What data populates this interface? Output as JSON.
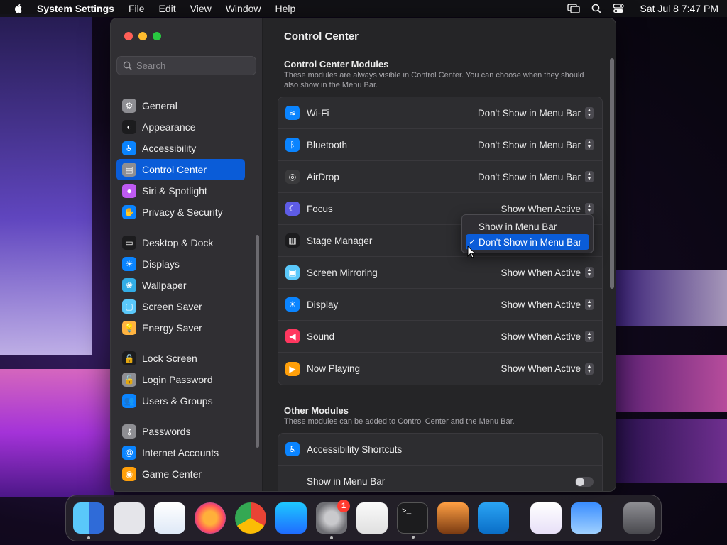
{
  "menubar": {
    "app_name": "System Settings",
    "menus": [
      "File",
      "Edit",
      "View",
      "Window",
      "Help"
    ],
    "clock": "Sat Jul 8  7:47 PM"
  },
  "sidebar": {
    "search_placeholder": "Search",
    "groups": [
      [
        {
          "label": "General",
          "icon": "gear-icon",
          "color": "#8e8e93"
        },
        {
          "label": "Appearance",
          "icon": "appearance-icon",
          "color": "#1c1c1e"
        },
        {
          "label": "Accessibility",
          "icon": "accessibility-icon",
          "color": "#0a84ff"
        },
        {
          "label": "Control Center",
          "icon": "control-center-icon",
          "color": "#8e8e93",
          "active": true
        },
        {
          "label": "Siri & Spotlight",
          "icon": "siri-icon",
          "color": "#bf5af2"
        },
        {
          "label": "Privacy & Security",
          "icon": "hand-icon",
          "color": "#0a84ff"
        }
      ],
      [
        {
          "label": "Desktop & Dock",
          "icon": "dock-icon",
          "color": "#1c1c1e"
        },
        {
          "label": "Displays",
          "icon": "sun-icon",
          "color": "#0a84ff"
        },
        {
          "label": "Wallpaper",
          "icon": "wallpaper-icon",
          "color": "#32ade6"
        },
        {
          "label": "Screen Saver",
          "icon": "screen-saver-icon",
          "color": "#5ac8fa"
        },
        {
          "label": "Energy Saver",
          "icon": "bulb-icon",
          "color": "#ffb340"
        }
      ],
      [
        {
          "label": "Lock Screen",
          "icon": "lock-icon",
          "color": "#1c1c1e"
        },
        {
          "label": "Login Password",
          "icon": "login-lock-icon",
          "color": "#8e8e93"
        },
        {
          "label": "Users & Groups",
          "icon": "users-icon",
          "color": "#0a84ff"
        }
      ],
      [
        {
          "label": "Passwords",
          "icon": "key-icon",
          "color": "#8e8e93"
        },
        {
          "label": "Internet Accounts",
          "icon": "at-icon",
          "color": "#0a84ff"
        },
        {
          "label": "Game Center",
          "icon": "game-center-icon",
          "color": "#ff9f0a"
        }
      ]
    ]
  },
  "main": {
    "title": "Control Center",
    "modules_section": {
      "heading": "Control Center Modules",
      "description": "These modules are always visible in Control Center. You can choose when they should also show in the Menu Bar.",
      "rows": [
        {
          "label": "Wi-Fi",
          "value": "Don't Show in Menu Bar",
          "icon": "wifi-icon",
          "color": "#0a84ff"
        },
        {
          "label": "Bluetooth",
          "value": "Don't Show in Menu Bar",
          "icon": "bluetooth-icon",
          "color": "#0a84ff"
        },
        {
          "label": "AirDrop",
          "value": "Don't Show in Menu Bar",
          "icon": "airdrop-icon",
          "color": "#3a3a3c"
        },
        {
          "label": "Focus",
          "value": "Show When Active",
          "icon": "moon-icon",
          "color": "#5e5ce6"
        },
        {
          "label": "Stage Manager",
          "value": "",
          "icon": "stage-manager-icon",
          "color": "#1c1c1e"
        },
        {
          "label": "Screen Mirroring",
          "value": "Show When Active",
          "icon": "screen-mirroring-icon",
          "color": "#5ac8fa"
        },
        {
          "label": "Display",
          "value": "Show When Active",
          "icon": "sun-icon",
          "color": "#0a84ff"
        },
        {
          "label": "Sound",
          "value": "Show When Active",
          "icon": "speaker-icon",
          "color": "#ff375f"
        },
        {
          "label": "Now Playing",
          "value": "Show When Active",
          "icon": "play-icon",
          "color": "#ff9f0a"
        }
      ]
    },
    "other_section": {
      "heading": "Other Modules",
      "description": "These modules can be added to Control Center and the Menu Bar.",
      "rows": [
        {
          "label": "Accessibility Shortcuts",
          "icon": "accessibility-icon",
          "color": "#0a84ff"
        },
        {
          "label": "Show in Menu Bar",
          "toggle": false
        }
      ]
    }
  },
  "dropdown": {
    "options": [
      "Show in Menu Bar",
      "Don't Show in Menu Bar"
    ],
    "selected_index": 1,
    "check": "✓"
  },
  "dock": {
    "settings_badge": "1",
    "apps": [
      "finder-icon",
      "launchpad-icon",
      "safari-icon",
      "firefox-icon",
      "chrome-icon",
      "app-store-icon",
      "system-settings-icon",
      "textedit-icon",
      "terminal-icon",
      "garageband-icon",
      "vscode-icon",
      "visual-studio-icon",
      "weather-icon",
      "trash-icon"
    ]
  }
}
